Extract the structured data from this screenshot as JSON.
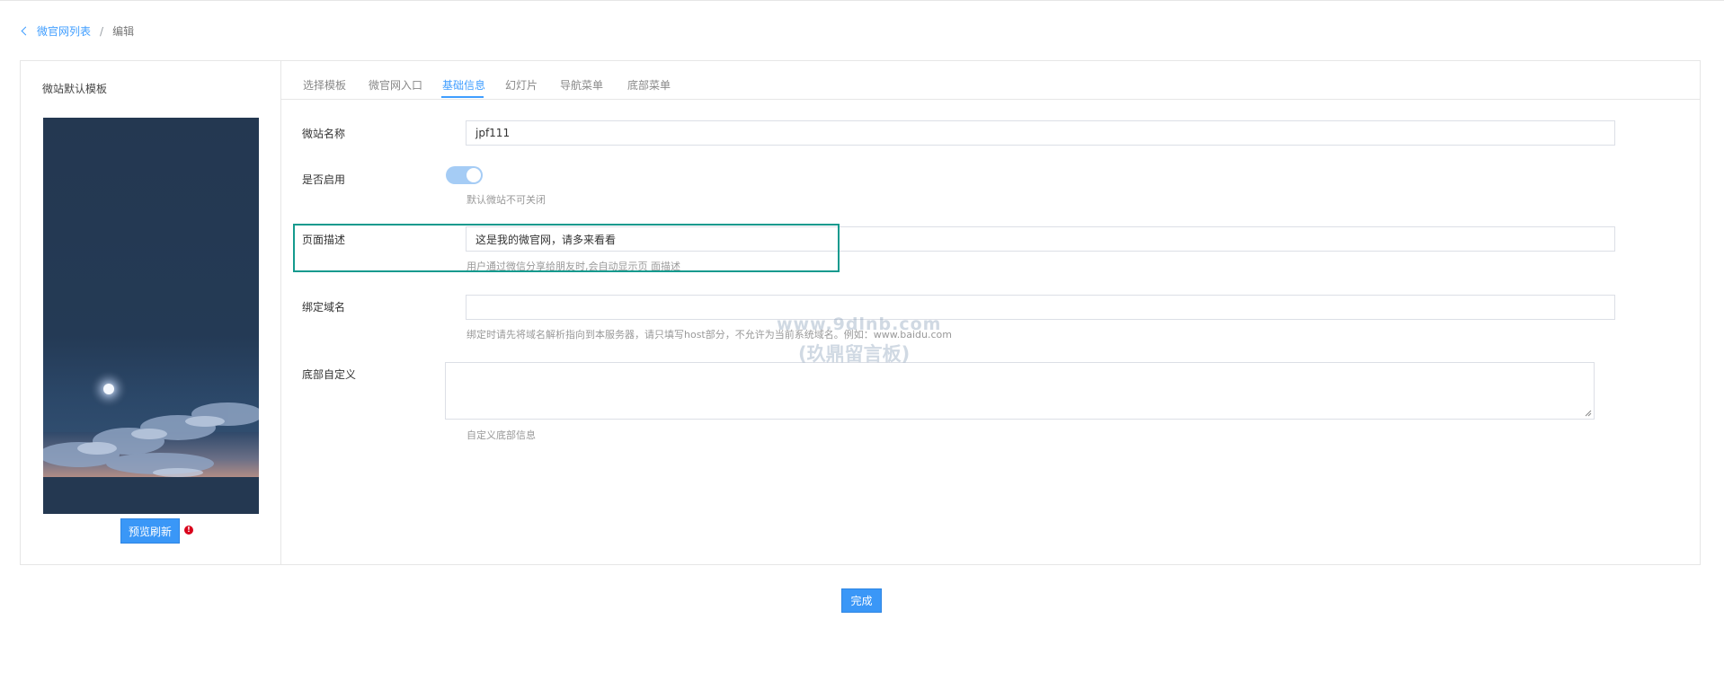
{
  "breadcrumb": {
    "back_label": "微官网列表",
    "separator": "/",
    "current": "编辑"
  },
  "left_panel": {
    "title": "微站默认模板",
    "preview_button": "预览刷新",
    "info_icon": "!"
  },
  "tabs": [
    {
      "label": "选择模板",
      "active": false
    },
    {
      "label": "微官网入口",
      "active": false
    },
    {
      "label": "基础信息",
      "active": true
    },
    {
      "label": "幻灯片",
      "active": false
    },
    {
      "label": "导航菜单",
      "active": false
    },
    {
      "label": "底部菜单",
      "active": false
    }
  ],
  "form": {
    "site_name": {
      "label": "微站名称",
      "value": "jpf111"
    },
    "enabled": {
      "label": "是否启用",
      "on": true,
      "hint": "默认微站不可关闭"
    },
    "description": {
      "label": "页面描述",
      "value": "这是我的微官网，请多来看看",
      "hint": "用户通过微信分享给朋友时,会自动显示页 面描述"
    },
    "domain": {
      "label": "绑定域名",
      "value": "",
      "hint": "绑定时请先将域名解析指向到本服务器，请只填写host部分，不允许为当前系统域名。例如：www.baidu.com"
    },
    "footer": {
      "label": "底部自定义",
      "value": "",
      "hint": "自定义底部信息"
    }
  },
  "watermark": {
    "line1": "www.9dlnb.com",
    "line2": "(玖鼎留言板)"
  },
  "actions": {
    "done_label": "完成"
  },
  "colors": {
    "accent": "#409eff",
    "button": "#3a97f7",
    "highlight": "#149a8e",
    "danger": "#d9001b"
  }
}
